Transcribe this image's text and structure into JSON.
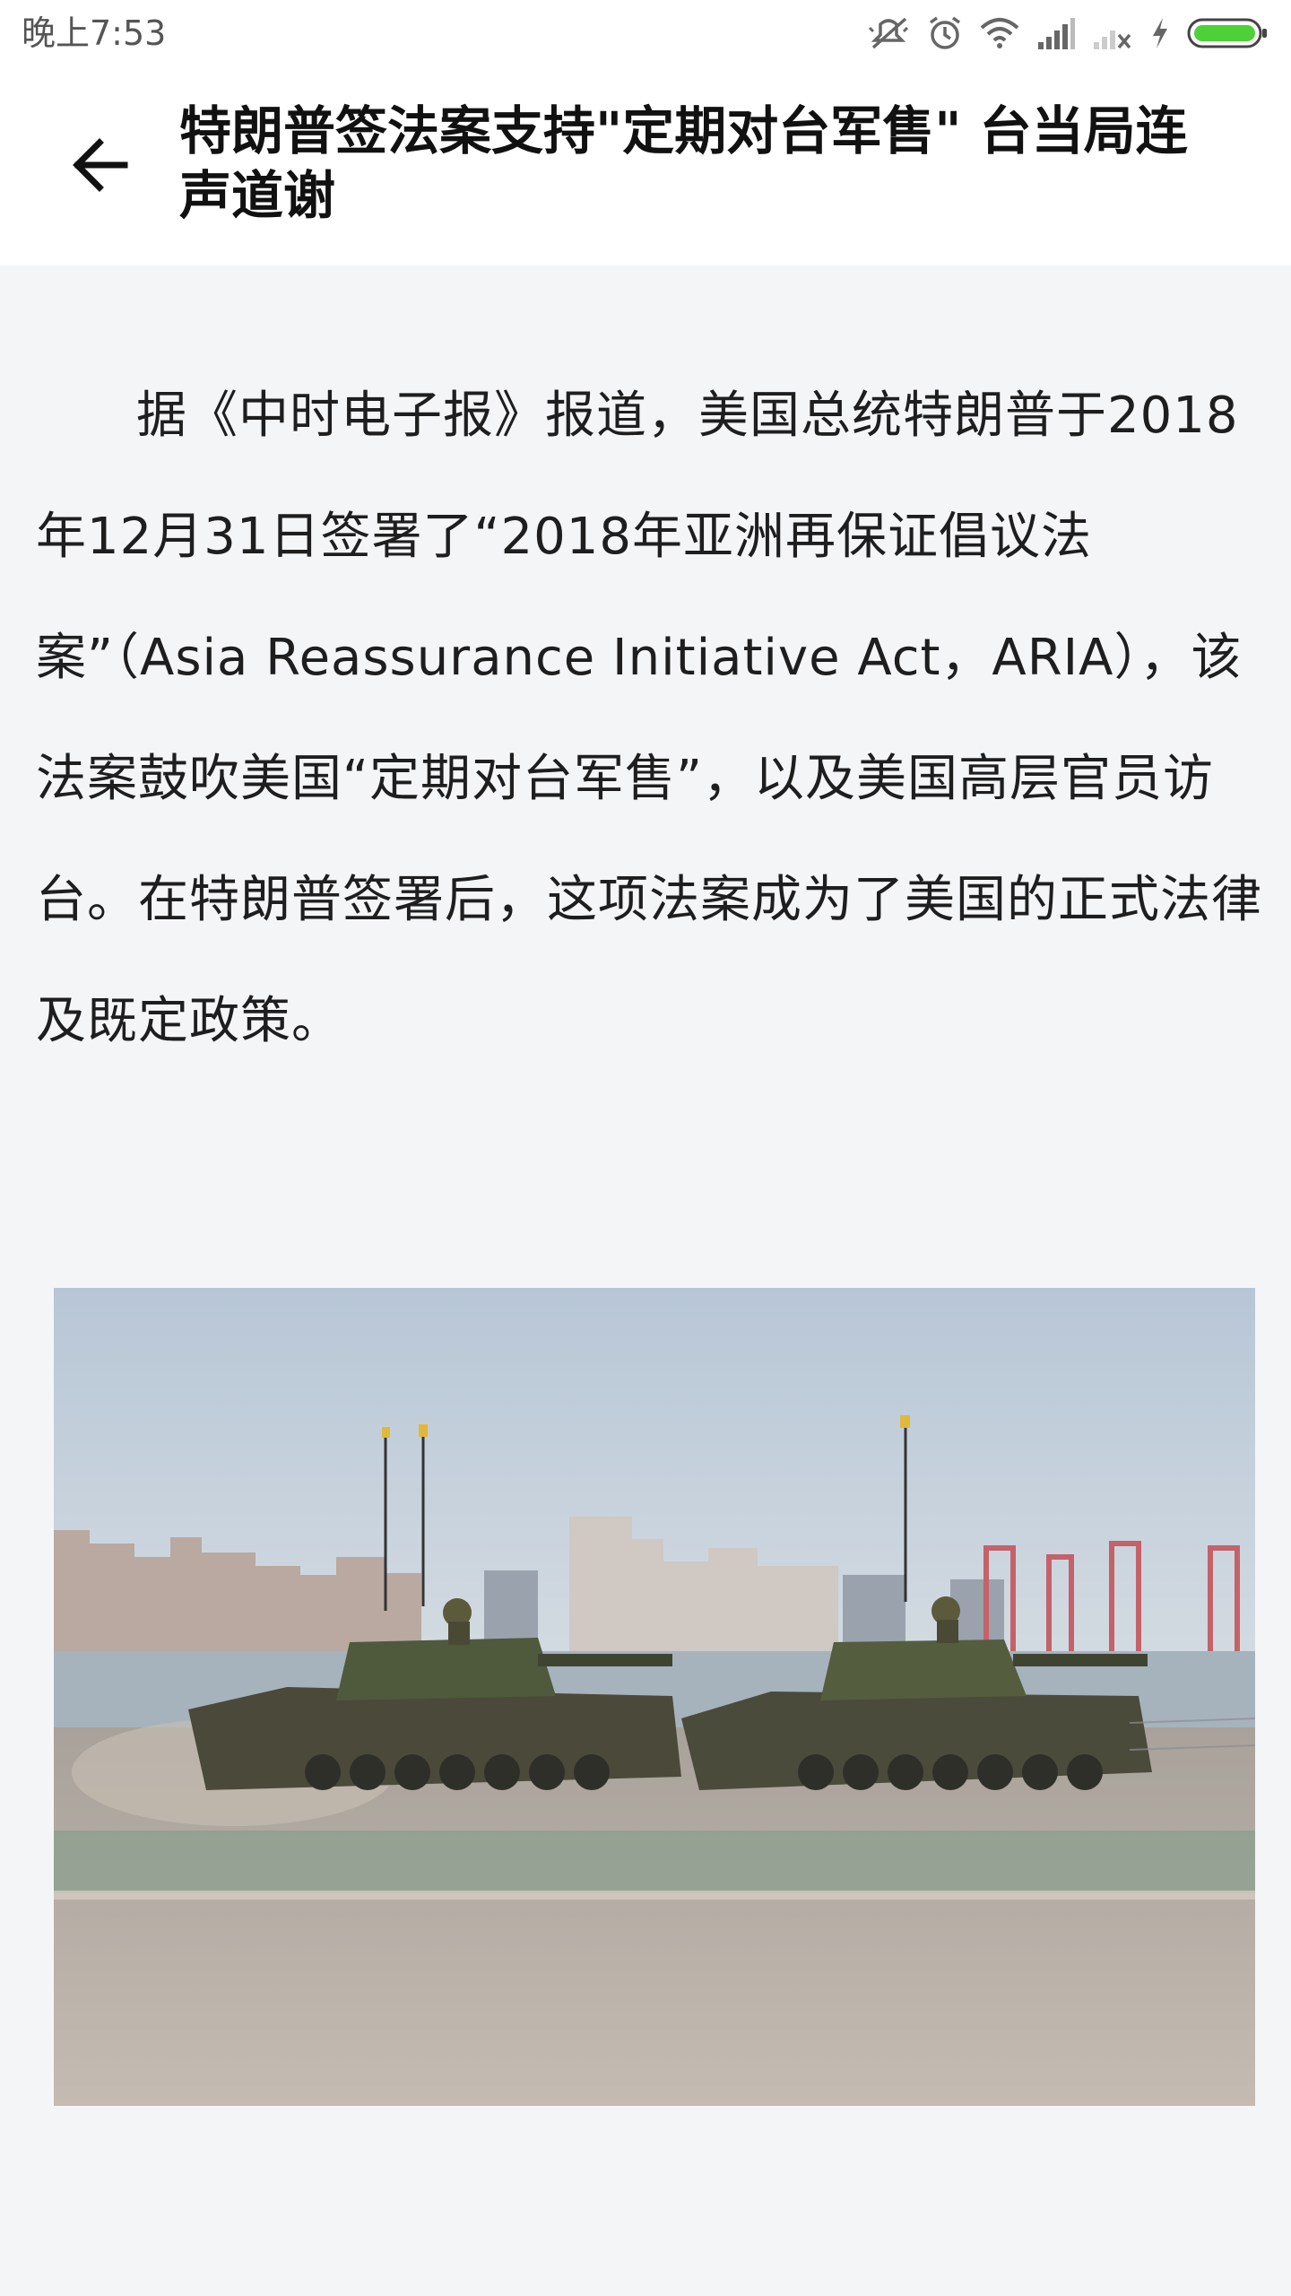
{
  "status_bar": {
    "time": "晚上7:53",
    "icons": [
      "mute-icon",
      "alarm-icon",
      "wifi-icon",
      "signal-icon",
      "no-signal-icon",
      "charging-icon",
      "battery-icon"
    ],
    "battery_color": "#4cd137"
  },
  "header": {
    "back_icon": "arrow-left-icon",
    "title": "特朗普签法案支持\"定期对台军售\" 台当局连声道谢"
  },
  "article": {
    "paragraph": "据《中时电子报》报道，美国总统特朗普于2018年12月31日签署了“2018年亚洲再保证倡议法案”（Asia Reassurance Initiative Act，ARIA），该法案鼓吹美国“定期对台军售”，以及美国高层官员访台。在特朗普签署后，这项法案成为了美国的正式法律及既定政策。",
    "image_subject": "tanks-on-coastal-base-photo"
  },
  "colors": {
    "background": "#f4f5f7",
    "header_bg": "#ffffff",
    "text": "#1e1e1e"
  }
}
